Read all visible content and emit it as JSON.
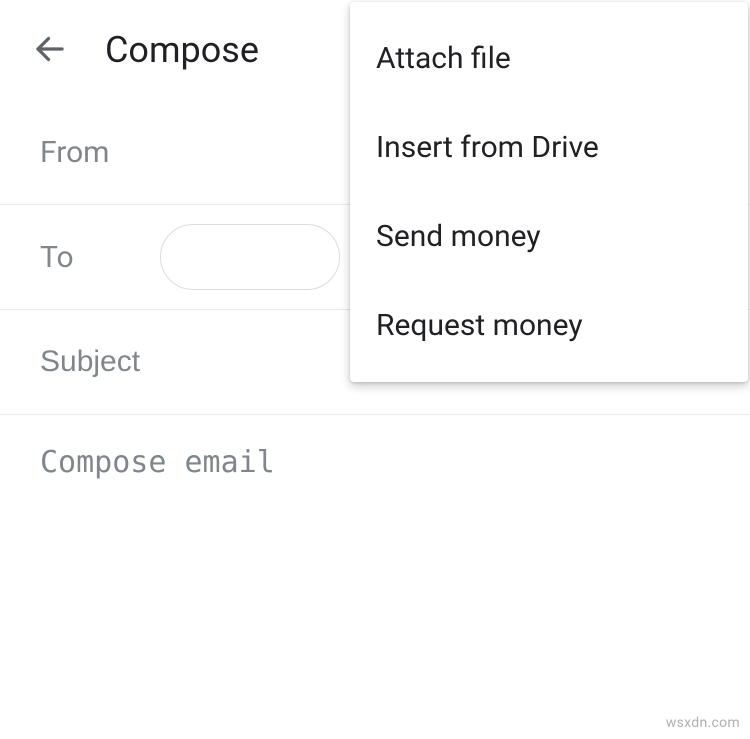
{
  "header": {
    "title": "Compose"
  },
  "fields": {
    "from_label": "From",
    "to_label": "To",
    "to_chip": "",
    "subject_placeholder": "Subject",
    "body_placeholder": "Compose email"
  },
  "menu": {
    "items": [
      {
        "label": "Attach file"
      },
      {
        "label": "Insert from Drive"
      },
      {
        "label": "Send money"
      },
      {
        "label": "Request money"
      }
    ]
  },
  "watermark": "wsxdn.com"
}
